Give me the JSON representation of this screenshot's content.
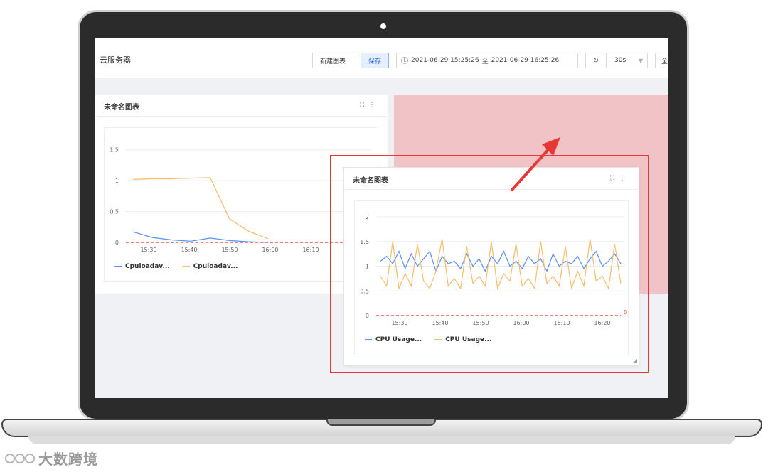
{
  "header": {
    "app_title": "云服务器",
    "new_chart_label": "新建图表",
    "save_label": "保存",
    "time_start": "2021-06-29 15:25:26",
    "time_separator": "至",
    "time_end": "2021-06-29 16:25:26",
    "refresh_interval": "30s",
    "edge_button_label": "全"
  },
  "panels": {
    "left": {
      "title": "未命名图表",
      "legend": [
        "Cpuloadav...",
        "Cpuloadav..."
      ]
    },
    "popout": {
      "title": "未命名图表",
      "legend": [
        "CPU Usage...",
        "CPU Usage..."
      ]
    }
  },
  "watermark": {
    "text": "大数跨境"
  },
  "colors": {
    "accent": "#2f6bd8",
    "series_blue": "#5b8ff9",
    "series_orange": "#f6bd6b",
    "threshold": "#e53935",
    "drop_zone": "#f1c2c6",
    "highlight": "#e53935"
  },
  "chart_data": [
    {
      "type": "line",
      "title": "未命名图表",
      "x": [
        "15:25",
        "15:30",
        "15:35",
        "15:40",
        "15:45",
        "15:50",
        "15:55",
        "16:00"
      ],
      "x_ticks": [
        "15:30",
        "15:40",
        "15:50",
        "16:00",
        "16:10"
      ],
      "y_ticks": [
        "0",
        "0.5",
        "1",
        "1.5"
      ],
      "ylim": [
        0,
        1.6
      ],
      "series": [
        {
          "name": "Cpuloadav...",
          "color": "#5b8ff9",
          "values": [
            0.17,
            0.08,
            0.04,
            0.02,
            0.07,
            0.03,
            0.01,
            0.0
          ]
        },
        {
          "name": "Cpuloadav...",
          "color": "#f6bd6b",
          "values": [
            1.02,
            1.03,
            1.03,
            1.04,
            1.05,
            0.38,
            0.18,
            0.06
          ]
        }
      ],
      "threshold": 0
    },
    {
      "type": "line",
      "title": "未命名图表",
      "x_ticks": [
        "15:30",
        "15:40",
        "15:50",
        "16:00",
        "16:10",
        "16:20"
      ],
      "y_ticks": [
        "0",
        "0.5",
        "1",
        "1.5",
        "2"
      ],
      "ylim": [
        0,
        2
      ],
      "series": [
        {
          "name": "CPU Usage...",
          "color": "#5b8ff9",
          "values": [
            1.1,
            1.2,
            1.05,
            1.3,
            0.95,
            1.25,
            1.0,
            1.15,
            1.3,
            0.9,
            1.2,
            1.05,
            1.1,
            0.95,
            1.25,
            1.0,
            1.15,
            0.9,
            1.2,
            1.05,
            1.3,
            1.0,
            1.1,
            0.95,
            1.2,
            1.05,
            1.15,
            0.9,
            1.25,
            1.0,
            1.1,
            1.05,
            1.2,
            0.95,
            1.15,
            1.3,
            1.0,
            1.1,
            1.25,
            1.05
          ]
        },
        {
          "name": "CPU Usage...",
          "color": "#f6bd6b",
          "values": [
            0.8,
            0.6,
            1.5,
            0.55,
            0.85,
            0.6,
            1.45,
            0.7,
            0.55,
            0.9,
            1.55,
            0.6,
            0.75,
            0.55,
            1.4,
            0.65,
            0.8,
            0.6,
            1.5,
            0.55,
            0.85,
            0.7,
            1.45,
            0.6,
            0.75,
            0.55,
            1.5,
            0.65,
            0.8,
            0.6,
            1.4,
            0.55,
            0.9,
            0.6,
            1.55,
            0.7,
            0.8,
            0.55,
            1.45,
            0.65
          ]
        }
      ],
      "threshold": 0,
      "threshold_label": "0"
    }
  ]
}
